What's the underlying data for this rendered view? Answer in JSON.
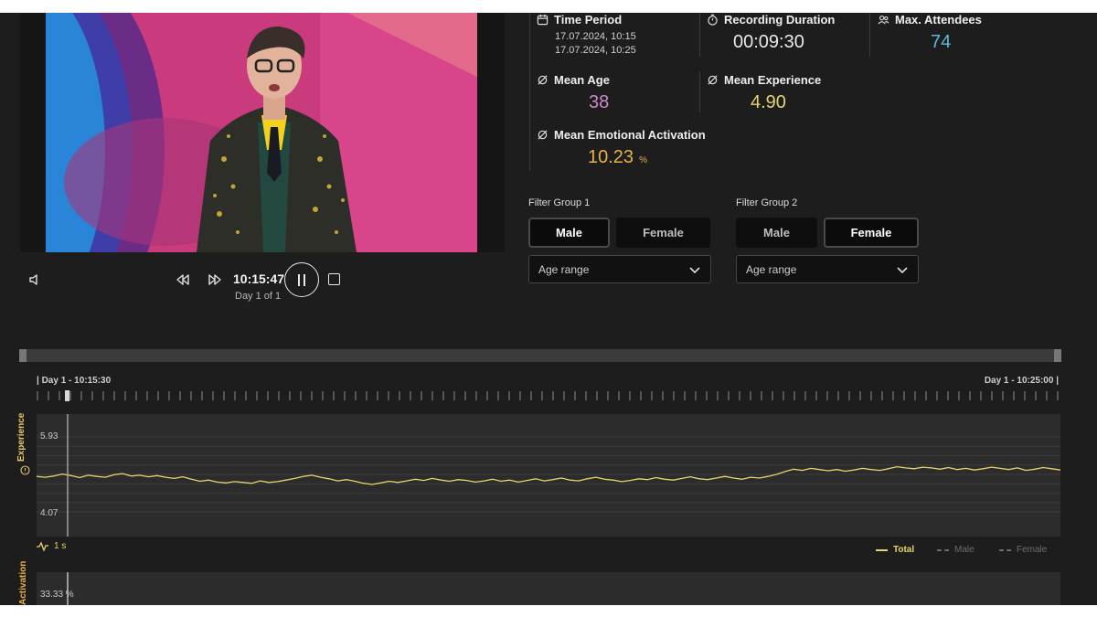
{
  "player": {
    "time": "10:15:47",
    "day": "Day 1 of 1"
  },
  "stats": {
    "time_period": {
      "label": "Time Period",
      "start": "17.07.2024, 10:15",
      "end": "17.07.2024, 10:25"
    },
    "recording_duration": {
      "label": "Recording Duration",
      "value": "00:09:30"
    },
    "max_attendees": {
      "label": "Max. Attendees",
      "value": "74"
    },
    "mean_age": {
      "label": "Mean Age",
      "value": "38"
    },
    "mean_experience": {
      "label": "Mean Experience",
      "value": "4.90"
    },
    "mean_activation": {
      "label": "Mean Emotional Activation",
      "value": "10.23",
      "unit": "%"
    }
  },
  "filters": {
    "group1": {
      "title": "Filter Group 1",
      "male": "Male",
      "female": "Female",
      "selected": "Male",
      "age_placeholder": "Age range"
    },
    "group2": {
      "title": "Filter Group 2",
      "male": "Male",
      "female": "Female",
      "selected": "Female",
      "age_placeholder": "Age range"
    }
  },
  "timeline": {
    "start_label": "| Day 1 - 10:15:30",
    "end_label": "Day 1 - 10:25:00 |"
  },
  "experience_chart": {
    "axis_title": "Experience",
    "y_max_label": "5.93",
    "y_min_label": "4.07",
    "resolution": "1 s",
    "legend": {
      "total": "Total",
      "male": "Male",
      "female": "Female"
    }
  },
  "activation_chart": {
    "axis_title": "Activation",
    "y_max_label": "33.33 %"
  },
  "colors": {
    "experience_line": "#e6d36a",
    "attendees": "#5fb7d8",
    "age": "#c98ac9",
    "experience_value": "#e6d36a",
    "activation_value": "#e9b04a"
  },
  "chart_data": {
    "type": "line",
    "title": "",
    "xlabel": "",
    "ylabel": "Experience",
    "x_range": [
      "10:15:30",
      "10:25:00"
    ],
    "ylim": [
      4.07,
      5.93
    ],
    "series": [
      {
        "name": "Total",
        "values": [
          4.95,
          4.93,
          4.96,
          5.01,
          4.97,
          4.92,
          4.98,
          4.95,
          4.93,
          4.99,
          5.02,
          4.96,
          4.98,
          4.94,
          4.97,
          4.93,
          4.9,
          4.94,
          4.88,
          4.83,
          4.86,
          4.81,
          4.79,
          4.82,
          4.8,
          4.78,
          4.84,
          4.8,
          4.82,
          4.86,
          4.9,
          4.95,
          4.98,
          4.93,
          4.89,
          4.84,
          4.87,
          4.83,
          4.78,
          4.75,
          4.79,
          4.83,
          4.8,
          4.84,
          4.88,
          4.85,
          4.9,
          4.86,
          4.83,
          4.87,
          4.85,
          4.81,
          4.84,
          4.88,
          4.83,
          4.86,
          4.81,
          4.85,
          4.89,
          4.84,
          4.87,
          4.91,
          4.86,
          4.84,
          4.89,
          4.93,
          4.88,
          4.86,
          4.82,
          4.85,
          4.89,
          4.87,
          4.92,
          4.88,
          4.86,
          4.9,
          4.94,
          4.89,
          4.87,
          4.91,
          4.95,
          4.91,
          4.88,
          4.93,
          4.91,
          4.95,
          5.0,
          5.07,
          5.13,
          5.1,
          5.15,
          5.12,
          5.09,
          5.12,
          5.08,
          5.11,
          5.15,
          5.12,
          5.1,
          5.14,
          5.19,
          5.16,
          5.14,
          5.18,
          5.16,
          5.13,
          5.17,
          5.12,
          5.15,
          5.11,
          5.14,
          5.18,
          5.15,
          5.12,
          5.16,
          5.1,
          5.13,
          5.17,
          5.14,
          5.11
        ]
      },
      {
        "name": "Male",
        "values": []
      },
      {
        "name": "Female",
        "values": []
      }
    ],
    "grid": true,
    "legend": "bottom-right"
  }
}
